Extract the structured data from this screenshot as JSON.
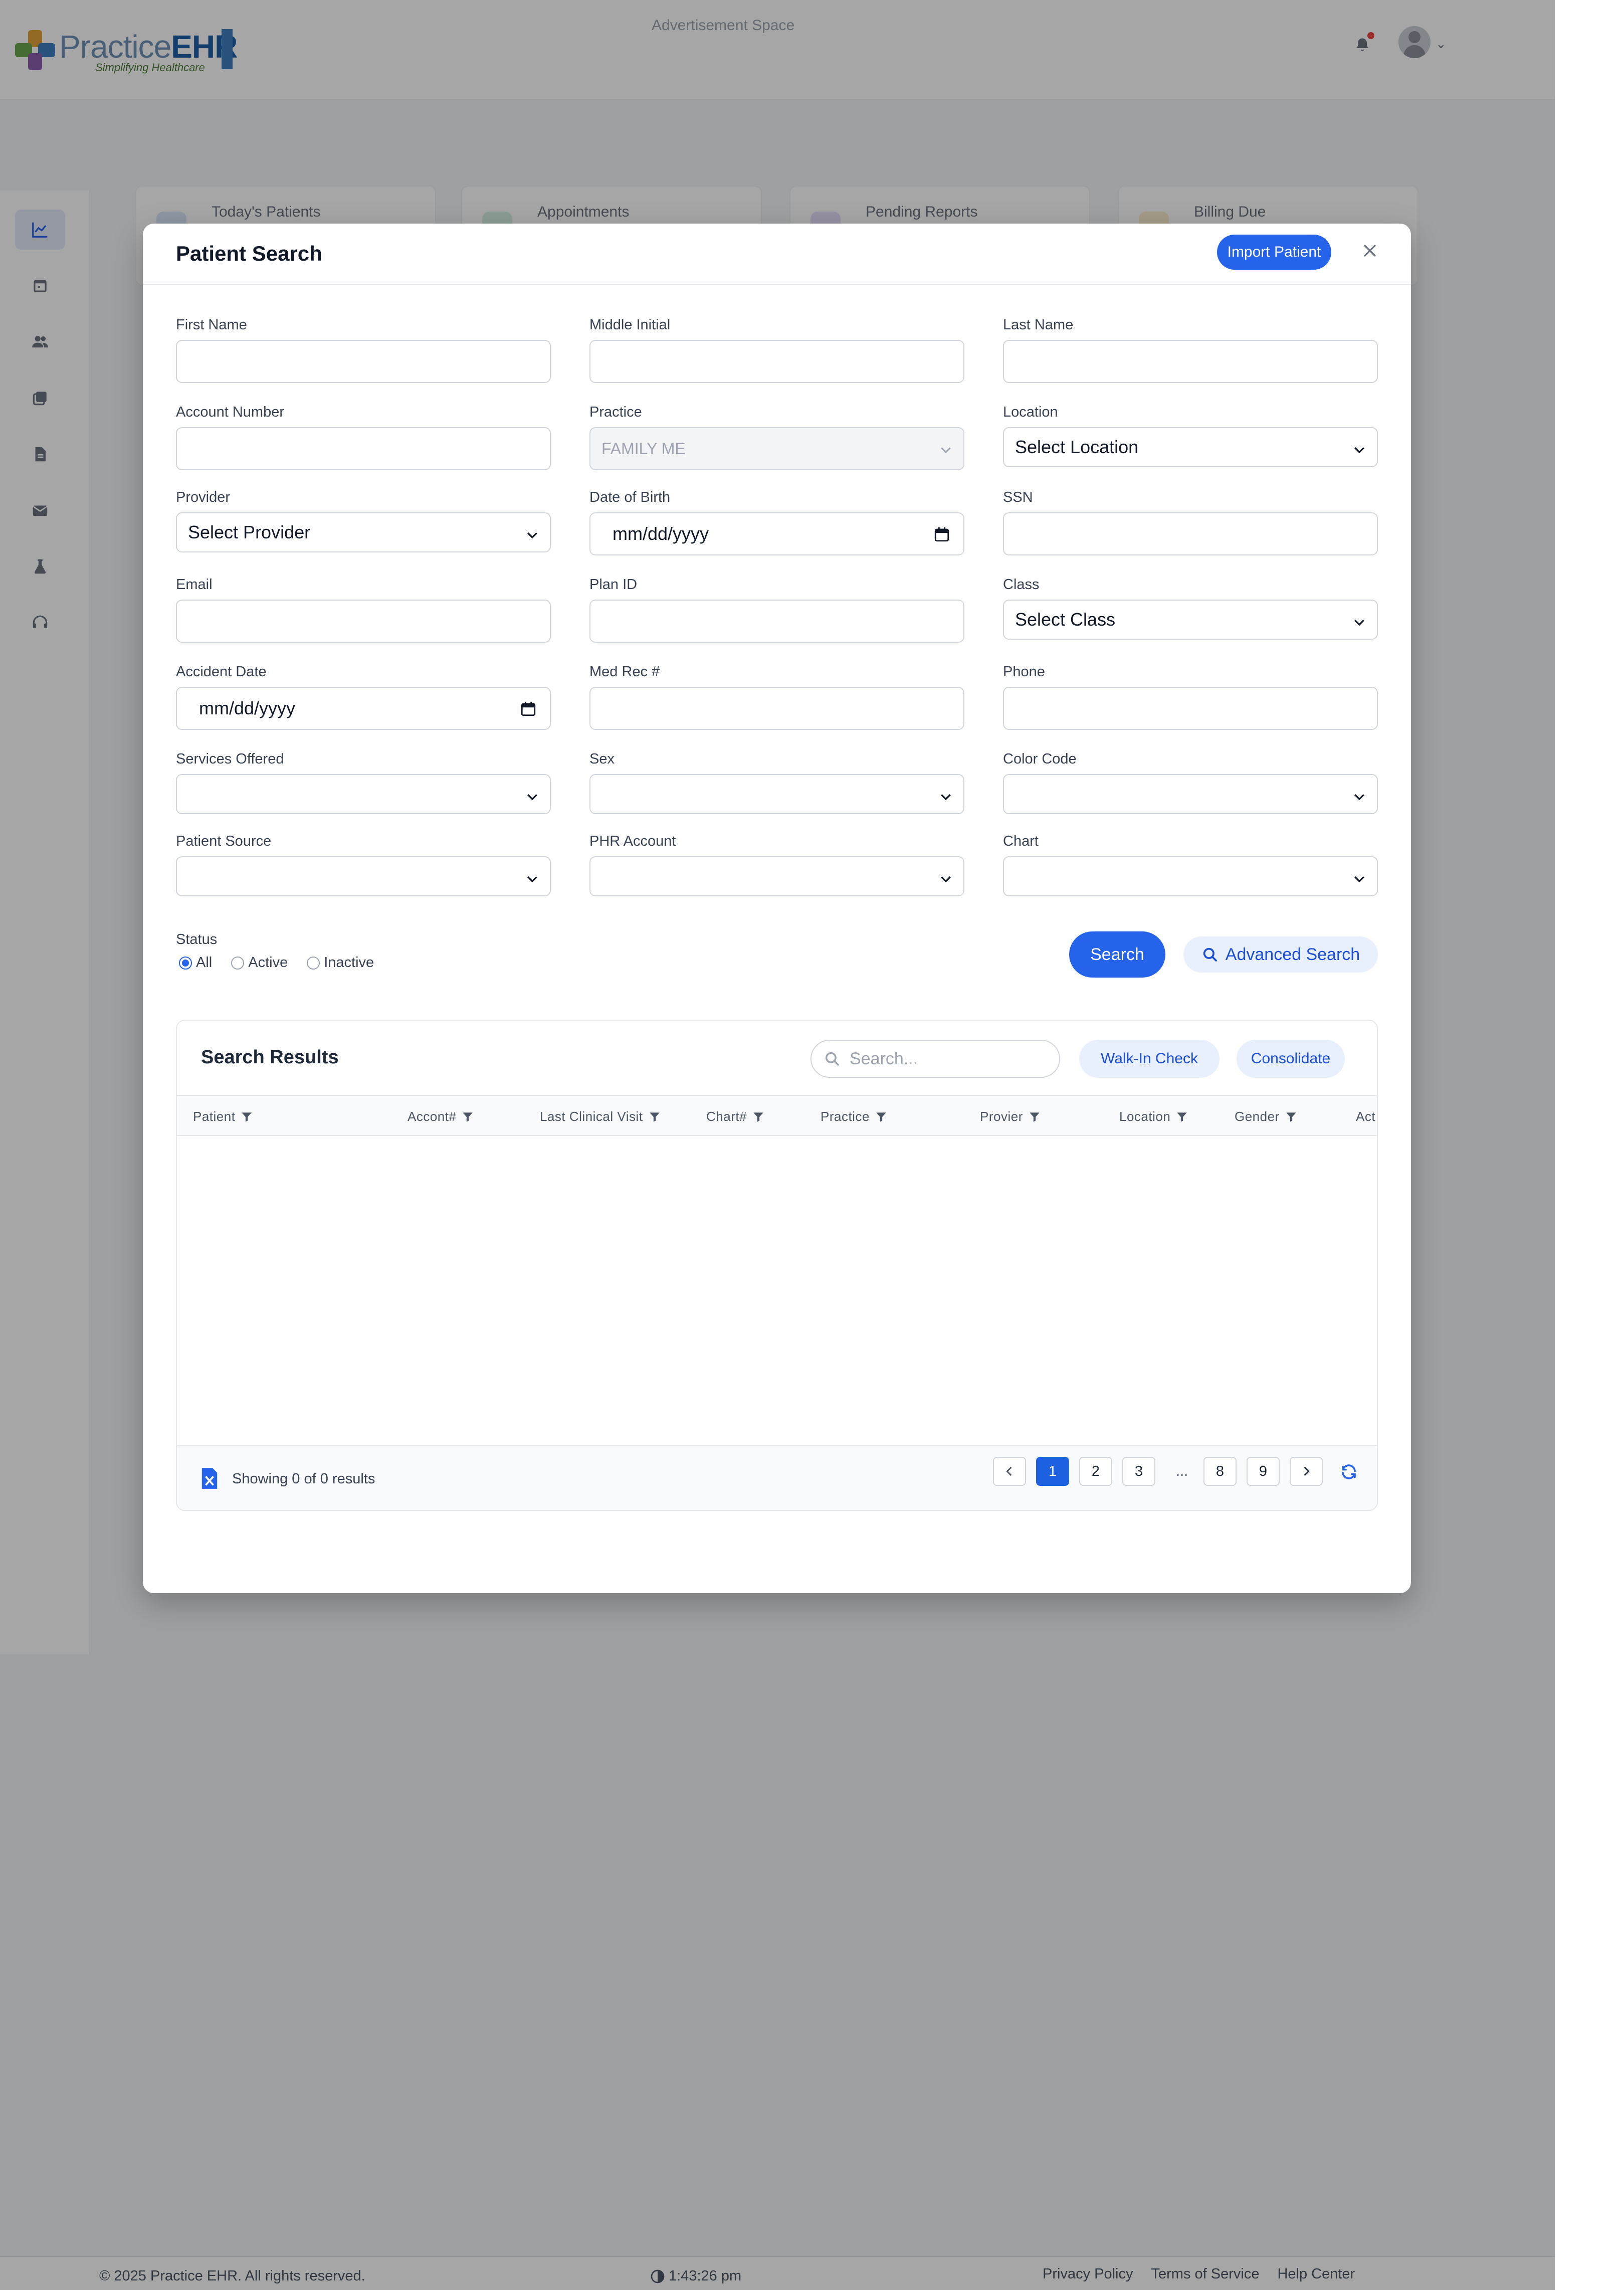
{
  "header": {
    "brand_light": "Practice",
    "brand_bold": "EHR",
    "tagline": "Simplifying Healthcare",
    "ad_text": "Advertisement Space"
  },
  "sidebar": {
    "icons": [
      "chart-line-icon",
      "calendar-icon",
      "users-icon",
      "copy-icon",
      "file-icon",
      "envelope-icon",
      "flask-icon",
      "headset-icon"
    ]
  },
  "dashboard": {
    "cards": [
      "Today's Patients",
      "Appointments",
      "Pending Reports",
      "Billing Due"
    ]
  },
  "modal": {
    "title": "Patient Search",
    "import_label": "Import Patient",
    "fields": {
      "first_name": {
        "label": "First Name",
        "value": ""
      },
      "middle_initial": {
        "label": "Middle Initial",
        "value": ""
      },
      "last_name": {
        "label": "Last Name",
        "value": ""
      },
      "account_number": {
        "label": "Account Number",
        "value": ""
      },
      "practice": {
        "label": "Practice",
        "value": "FAMILY ME"
      },
      "location": {
        "label": "Location",
        "value": "Select Location"
      },
      "provider": {
        "label": "Provider",
        "value": "Select Provider"
      },
      "dob": {
        "label": "Date of Birth",
        "value": "mm/dd/yyyy"
      },
      "ssn": {
        "label": "SSN",
        "value": ""
      },
      "email": {
        "label": "Email",
        "value": ""
      },
      "plan_id": {
        "label": "Plan ID",
        "value": ""
      },
      "class": {
        "label": "Class",
        "value": "Select Class"
      },
      "accident_date": {
        "label": "Accident Date",
        "value": "mm/dd/yyyy"
      },
      "med_rec": {
        "label": "Med Rec #",
        "value": ""
      },
      "phone": {
        "label": "Phone",
        "value": ""
      },
      "services_offered": {
        "label": "Services Offered",
        "value": ""
      },
      "sex": {
        "label": "Sex",
        "value": ""
      },
      "color_code": {
        "label": "Color Code",
        "value": ""
      },
      "patient_source": {
        "label": "Patient Source",
        "value": ""
      },
      "phr_account": {
        "label": "PHR Account",
        "value": ""
      },
      "chart": {
        "label": "Chart",
        "value": ""
      }
    },
    "status": {
      "label": "Status",
      "options": [
        "All",
        "Active",
        "Inactive"
      ],
      "selected": "All"
    },
    "search_label": "Search",
    "advanced_label": "Advanced Search"
  },
  "results": {
    "title": "Search Results",
    "search_placeholder": "Search...",
    "walkin_label": "Walk-In Check",
    "consolidate_label": "Consolidate",
    "columns": [
      "Patient",
      "Accont#",
      "Last Clinical Visit",
      "Chart#",
      "Practice",
      "Provier",
      "Location",
      "Gender",
      "Act"
    ],
    "rows": [],
    "showing": "Showing 0 of 0 results",
    "pages": [
      "1",
      "2",
      "3",
      "...",
      "8",
      "9"
    ],
    "current_page": "1"
  },
  "footer": {
    "copyright": "© 2025 Practice EHR. All rights reserved.",
    "time": "1:43:26 pm",
    "links": [
      "Privacy Policy",
      "Terms of Service",
      "Help Center"
    ]
  },
  "colors": {
    "primary": "#2563eb",
    "primary_light": "#e8f0fd",
    "overlay": "#000000"
  }
}
